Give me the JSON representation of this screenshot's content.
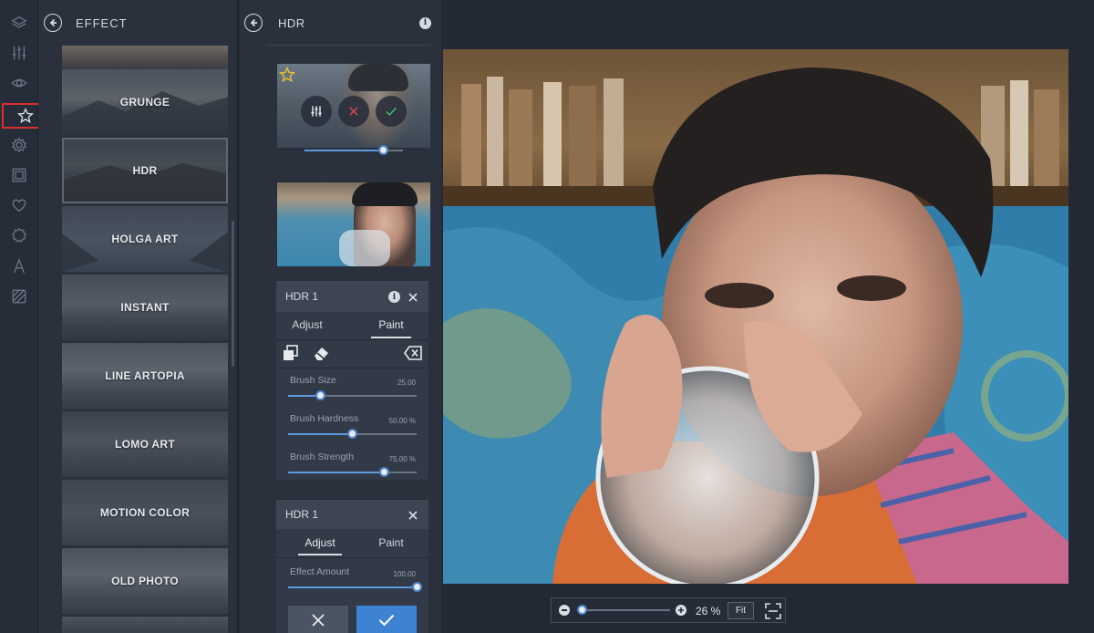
{
  "rail": {
    "icons": [
      "layers-icon",
      "adjustments-icon",
      "eye-icon",
      "star-icon",
      "gear-icon",
      "frame-icon",
      "heart-icon",
      "badge-icon",
      "text-icon",
      "texture-icon"
    ],
    "active": "star-icon"
  },
  "effects_panel": {
    "title": "EFFECT",
    "items": [
      {
        "label": "GRUNGE"
      },
      {
        "label": "HDR",
        "selected": true
      },
      {
        "label": "HOLGA ART"
      },
      {
        "label": "INSTANT"
      },
      {
        "label": "LINE ARTOPIA"
      },
      {
        "label": "LOMO ART"
      },
      {
        "label": "MOTION COLOR"
      },
      {
        "label": "OLD PHOTO"
      }
    ]
  },
  "hdr_panel": {
    "title": "HDR",
    "paint_card": {
      "title": "HDR 1",
      "tabs": [
        "Adjust",
        "Paint"
      ],
      "active_tab": "Paint",
      "sliders": [
        {
          "label": "Brush Size",
          "value": "25.00",
          "fraction": 0.25
        },
        {
          "label": "Brush Hardness",
          "value": "50.00 %",
          "fraction": 0.5
        },
        {
          "label": "Brush Strength",
          "value": "75.00 %",
          "fraction": 0.75
        }
      ]
    },
    "adjust_card": {
      "title": "HDR 1",
      "tabs": [
        "Adjust",
        "Paint"
      ],
      "active_tab": "Adjust",
      "sliders": [
        {
          "label": "Effect Amount",
          "value": "100.00",
          "fraction": 1.0
        }
      ]
    }
  },
  "zoom": {
    "value": "26 %",
    "fit_label": "Fit"
  },
  "colors": {
    "accent": "#3e82d4",
    "active_outline": "#d92f2f",
    "cancel_red": "#e04848",
    "confirm_green": "#3fc46a",
    "favorite_star": "#e9c233"
  }
}
